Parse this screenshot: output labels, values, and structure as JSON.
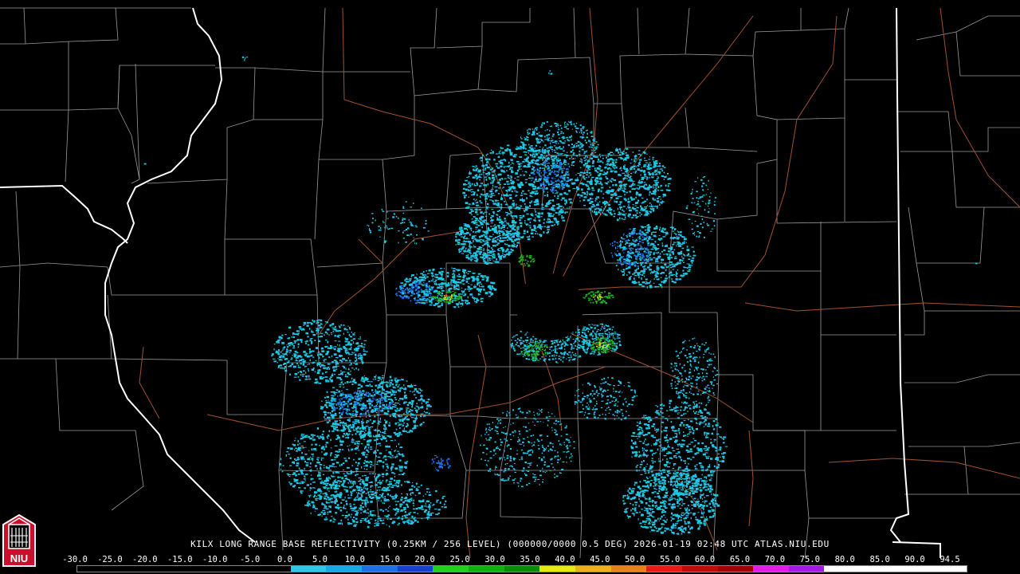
{
  "caption": "KILX LONG RANGE BASE REFLECTIVITY (0.25KM / 256 LEVEL) (000000/0000 0.5 DEG) 2026-01-19 02:48 UTC  ATLAS.NIU.EDU",
  "logo": {
    "text": "NIU",
    "colors": {
      "red": "#c8102e",
      "white": "#ffffff"
    }
  },
  "scale": {
    "labels": [
      "-30.0",
      "-25.0",
      "-20.0",
      "-15.0",
      "-10.0",
      "-5.0",
      "0.0",
      "5.0",
      "10.0",
      "15.0",
      "20.0",
      "25.0",
      "30.0",
      "35.0",
      "40.0",
      "45.0",
      "50.0",
      "55.0",
      "60.0",
      "65.0",
      "70.0",
      "75.0",
      "80.0",
      "85.0",
      "90.0",
      "94.5"
    ],
    "colors": [
      "#000000",
      "#000000",
      "#000000",
      "#000000",
      "#000000",
      "#000000",
      "#2ec8e6",
      "#17a9e6",
      "#1f6ee6",
      "#1a3fd0",
      "#1fd01f",
      "#10b010",
      "#0a8a0a",
      "#e6e61a",
      "#e6b41a",
      "#e6821a",
      "#e61a1a",
      "#c00a0a",
      "#a00000",
      "#e61ae6",
      "#a01ae6",
      "#ffffff",
      "#ffffff",
      "#ffffff",
      "#ffffff"
    ]
  },
  "map_colors": {
    "state_borders": "#ffffff",
    "county_lines": "#9a9a9a",
    "highways": "#a0522d",
    "echo_light": "#1ec8e6",
    "echo_mid": "#1f6ee6",
    "echo_green": "#1fb01f",
    "echo_yellow": "#e6e61a",
    "echo_red": "#e61a1a"
  }
}
